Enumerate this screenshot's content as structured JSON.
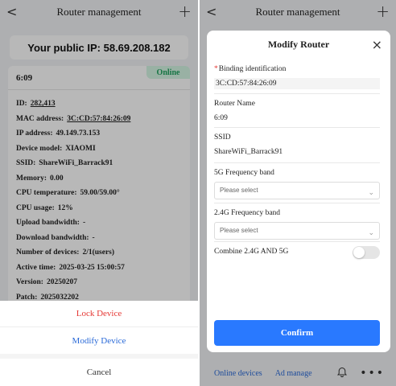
{
  "left": {
    "navbar": {
      "title": "Router management",
      "back_glyph": "<",
      "add_glyph": "+"
    },
    "public_ip": "Your public IP: 58.69.208.182",
    "router_card": {
      "name": "6:09",
      "status": "Online",
      "fields": [
        {
          "label": "ID:",
          "value": "282,413"
        },
        {
          "label": "MAC address:",
          "value": "3C:CD:57:84:26:09"
        },
        {
          "label": "IP address:",
          "value": "49.149.73.153"
        },
        {
          "label": "Device model:",
          "value": "XIAOMI"
        },
        {
          "label": "SSID:",
          "value": "ShareWiFi_Barrack91"
        },
        {
          "label": "Memory:",
          "value": "0.00"
        },
        {
          "label": "CPU temperature:",
          "value": "59.00/59.00°"
        },
        {
          "label": "CPU usage:",
          "value": "12%"
        },
        {
          "label": "Upload bandwidth:",
          "value": "-"
        },
        {
          "label": "Download bandwidth:",
          "value": "-"
        },
        {
          "label": "Number of devices:",
          "value": "2/1(users)"
        },
        {
          "label": "Active time:",
          "value": "2025-03-25 15:00:57"
        },
        {
          "label": "Version:",
          "value": "20250207"
        },
        {
          "label": "Patch:",
          "value": "2025032202"
        }
      ]
    },
    "action_sheet": {
      "lock": "Lock Device",
      "modify": "Modify Device",
      "cancel": "Cancel"
    }
  },
  "right": {
    "navbar": {
      "title": "Router management",
      "back_glyph": "<",
      "add_glyph": "+"
    },
    "modal": {
      "title": "Modify Router",
      "close_glyph": "×",
      "binding_label": "Binding identification",
      "binding_required_mark": "*",
      "binding_value": "3C:CD:57:84:26:09",
      "name_label": "Router Name",
      "name_value": "6:09",
      "ssid_label": "SSID",
      "ssid_value": "ShareWiFi_Barrack91",
      "band5_label": "5G Frequency band",
      "band5_placeholder": "Please select",
      "band24_label": "2.4G Frequency band",
      "band24_placeholder": "Please select",
      "combine_label": "Combine 2.4G AND 5G",
      "combine_on": false,
      "confirm": "Confirm"
    },
    "bottom_bar": {
      "online_devices": "Online devices",
      "ad_manage": "Ad manage",
      "more_glyph": "•••"
    }
  },
  "colors": {
    "online": "#20a35f",
    "lock": "#e53935",
    "link": "#2a6ad8",
    "primary": "#2979ff"
  }
}
